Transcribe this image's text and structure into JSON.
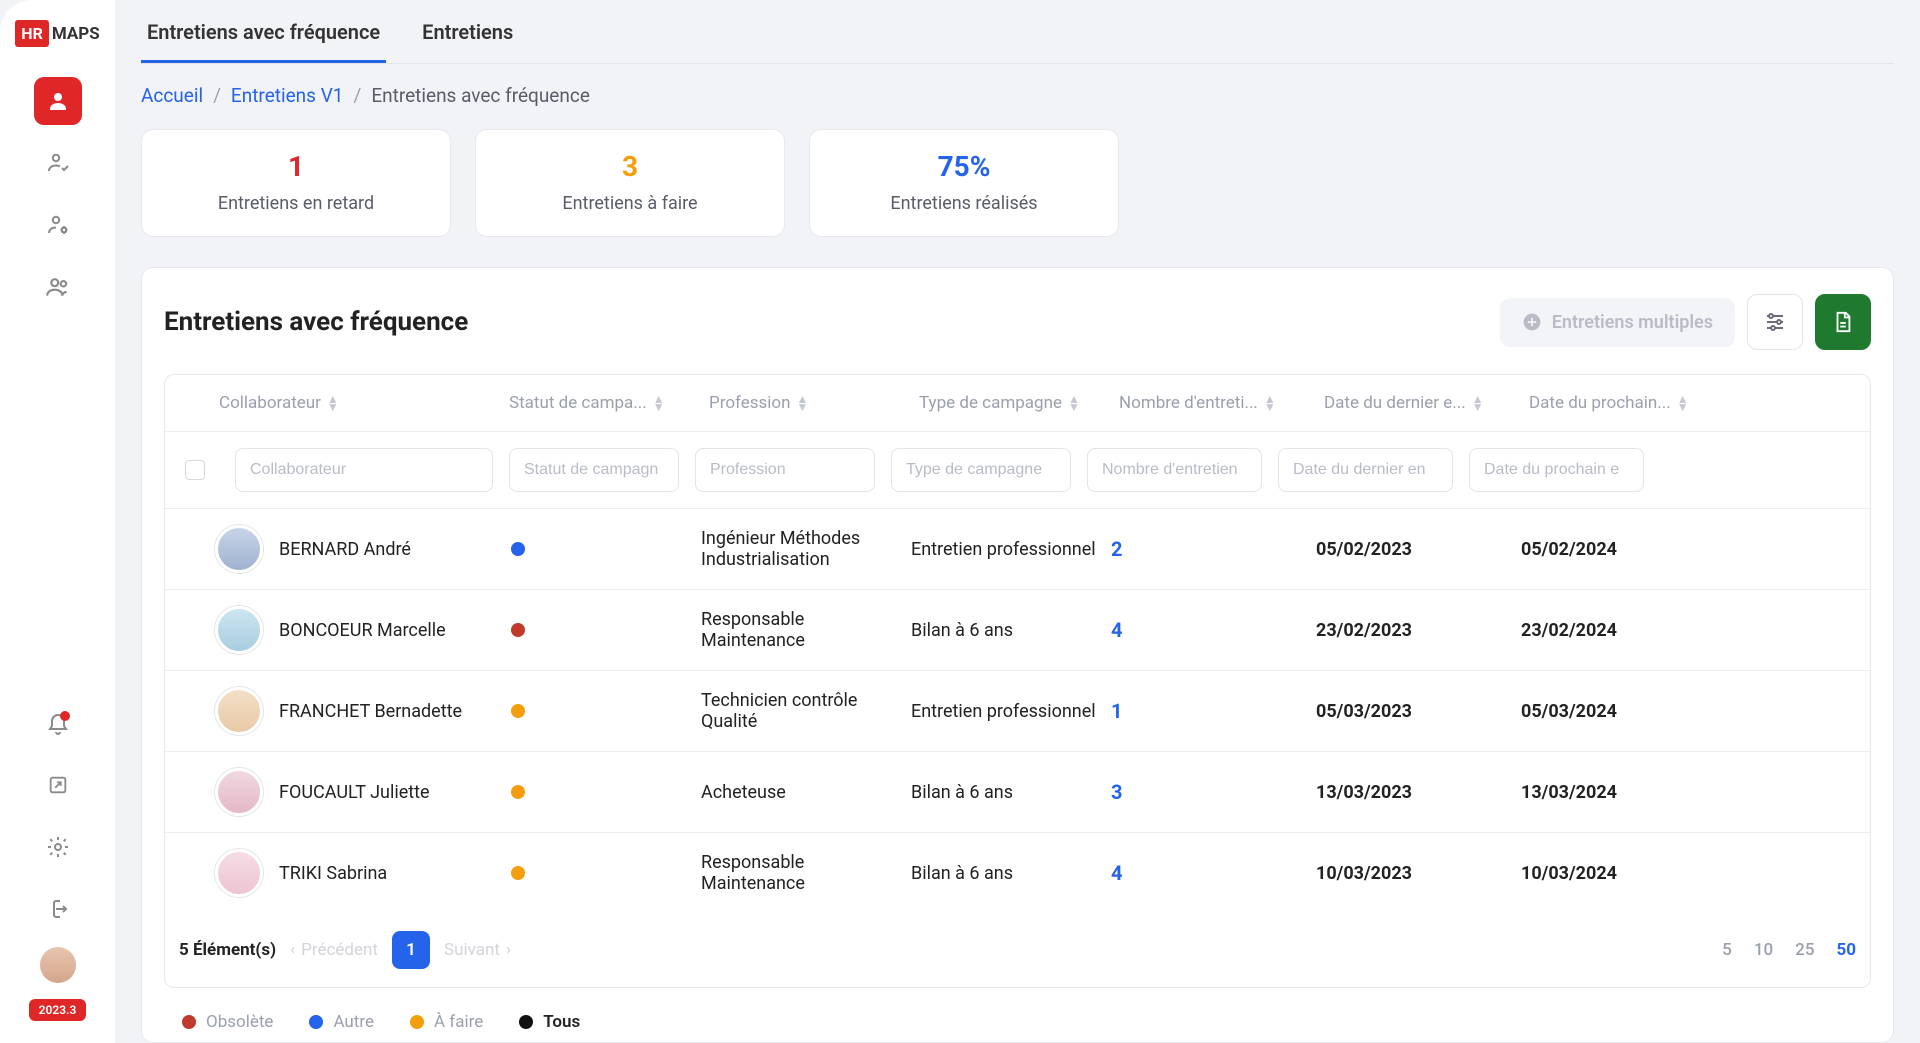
{
  "logo": {
    "box": "HR",
    "text": "MAPS"
  },
  "version": "2023.3",
  "tabs": [
    {
      "label": "Entretiens avec fréquence",
      "active": true
    },
    {
      "label": "Entretiens",
      "active": false
    }
  ],
  "breadcrumb": {
    "home": "Accueil",
    "mid": "Entretiens V1",
    "current": "Entretiens avec fréquence"
  },
  "stats": [
    {
      "value": "1",
      "label": "Entretiens en retard",
      "color": "#e02727"
    },
    {
      "value": "3",
      "label": "Entretiens à faire",
      "color": "#f59e0b"
    },
    {
      "value": "75%",
      "label": "Entretiens réalisés",
      "color": "#2563eb"
    }
  ],
  "panel": {
    "title": "Entretiens avec fréquence",
    "multi_btn": "Entretiens multiples"
  },
  "columns": {
    "collab": "Collaborateur",
    "status": "Statut de campa...",
    "prof": "Profession",
    "type": "Type de campagne",
    "num": "Nombre d'entreti...",
    "d1": "Date du dernier e...",
    "d2": "Date du prochain..."
  },
  "filters": {
    "collab": "Collaborateur",
    "status": "Statut de campagn",
    "prof": "Profession",
    "type": "Type de campagne",
    "num": "Nombre d'entretien",
    "d1": "Date du dernier en",
    "d2": "Date du prochain e"
  },
  "rows": [
    {
      "name": "BERNARD André",
      "status": "blue",
      "prof": "Ingénieur Méthodes Industrialisation",
      "type": "Entretien professionnel",
      "num": "2",
      "d1": "05/02/2023",
      "d2": "05/02/2024",
      "av": "av1"
    },
    {
      "name": "BONCOEUR Marcelle",
      "status": "red",
      "prof": "Responsable Maintenance",
      "type": "Bilan à 6 ans",
      "num": "4",
      "d1": "23/02/2023",
      "d2": "23/02/2024",
      "av": "av2"
    },
    {
      "name": "FRANCHET Bernadette",
      "status": "orange",
      "prof": "Technicien contrôle Qualité",
      "type": "Entretien professionnel",
      "num": "1",
      "d1": "05/03/2023",
      "d2": "05/03/2024",
      "av": "av3"
    },
    {
      "name": "FOUCAULT Juliette",
      "status": "orange",
      "prof": "Acheteuse",
      "type": "Bilan à 6 ans",
      "num": "3",
      "d1": "13/03/2023",
      "d2": "13/03/2024",
      "av": "av4"
    },
    {
      "name": "TRIKI Sabrina",
      "status": "orange",
      "prof": "Responsable Maintenance",
      "type": "Bilan à 6 ans",
      "num": "4",
      "d1": "10/03/2023",
      "d2": "10/03/2024",
      "av": "av5"
    }
  ],
  "pager": {
    "count": "5 Élément(s)",
    "prev": "Précédent",
    "cur": "1",
    "next": "Suivant",
    "sizes": [
      "5",
      "10",
      "25",
      "50"
    ]
  },
  "legend": [
    {
      "label": "Obsolète",
      "dot": "d-red"
    },
    {
      "label": "Autre",
      "dot": "d-blue"
    },
    {
      "label": "À faire",
      "dot": "d-orange"
    },
    {
      "label": "Tous",
      "dot": "d-black",
      "dark": true
    }
  ]
}
